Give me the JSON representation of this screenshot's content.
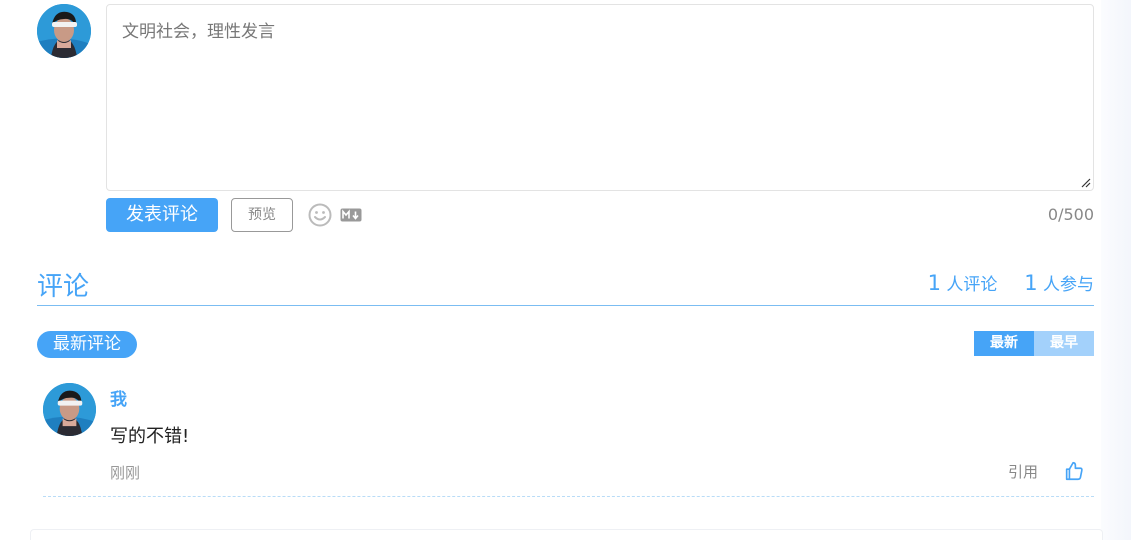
{
  "composer": {
    "placeholder": "文明社会，理性发言",
    "submit_label": "发表评论",
    "preview_label": "预览",
    "char_count": "0/500",
    "emoji_icon": "smiley-face-icon",
    "markdown_icon": "markdown-icon"
  },
  "comments_section": {
    "title": "评论",
    "comment_count": "1",
    "comment_count_label": "人评论",
    "participant_count": "1",
    "participant_count_label": "人参与",
    "latest_badge": "最新评论",
    "sort_newest": "最新",
    "sort_oldest": "最早",
    "comments": [
      {
        "author": "我",
        "text": "写的不错!",
        "time": "刚刚",
        "quote_label": "引用",
        "like_icon": "thumbs-up-icon"
      }
    ]
  },
  "colors": {
    "accent": "#46a4f7",
    "accent_light": "#a3d1fb",
    "border": "#e3e3e3",
    "muted_text": "#888888"
  }
}
